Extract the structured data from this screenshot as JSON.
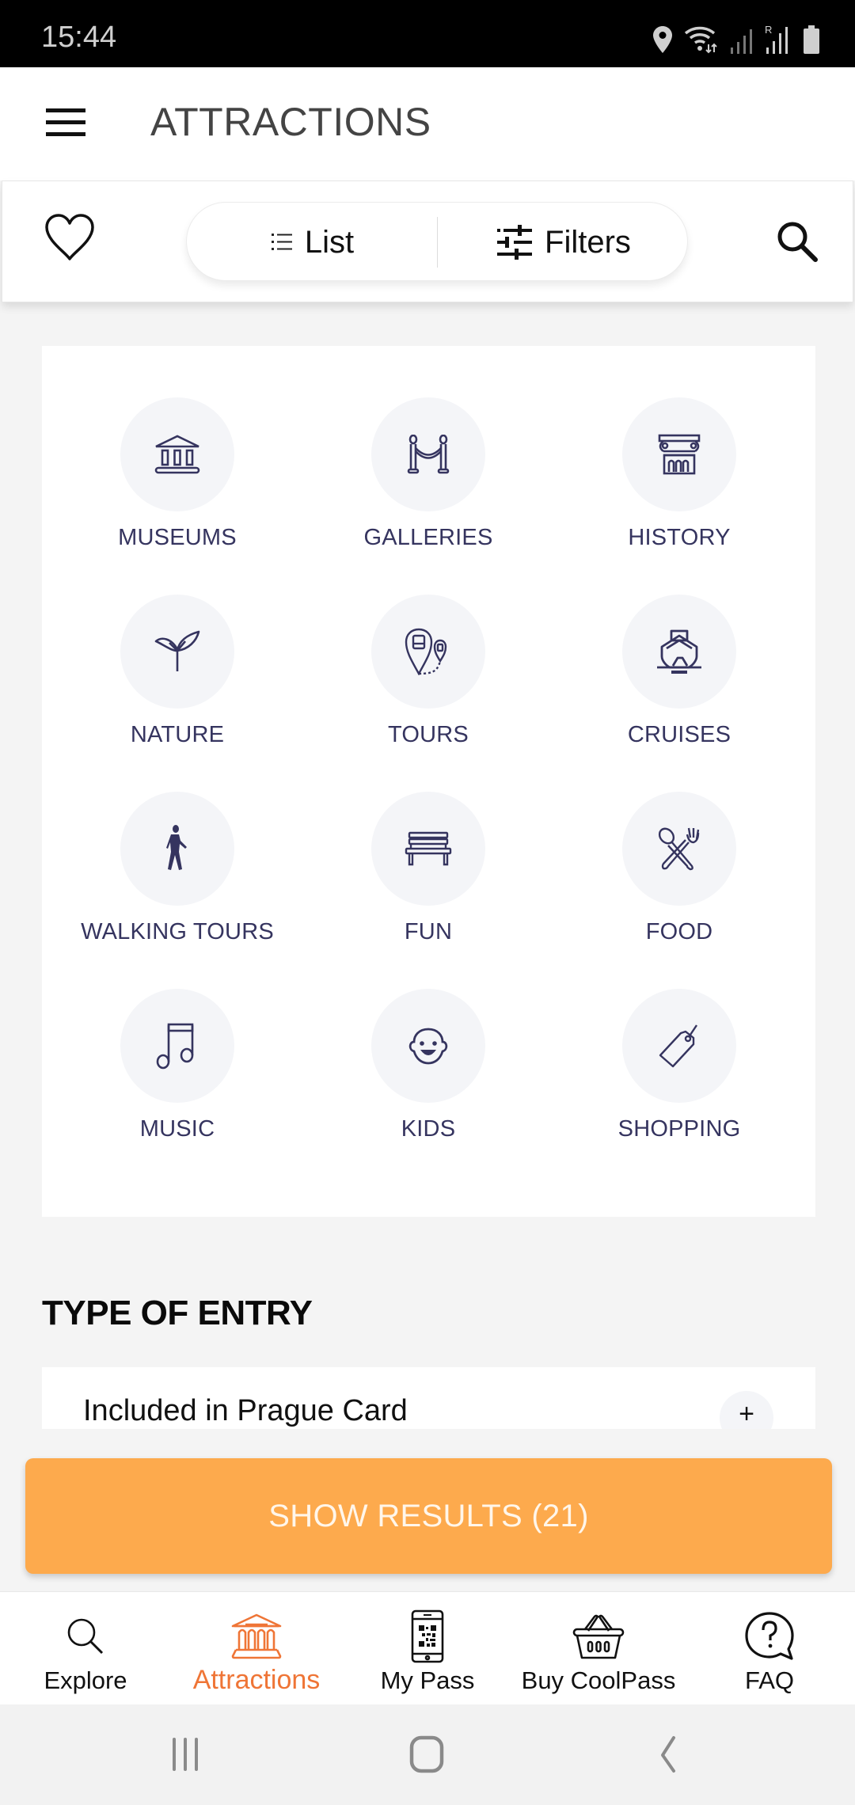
{
  "status_bar": {
    "time": "15:44",
    "icons": [
      "location-icon",
      "wifi-icon",
      "signal-icon",
      "roaming-signal-icon",
      "battery-icon"
    ],
    "roaming_label": "R"
  },
  "header": {
    "title": "ATTRACTIONS",
    "menu_icon": "hamburger-menu-icon"
  },
  "toolbar": {
    "favorites_icon": "heart-icon",
    "list_label": "List",
    "filters_label": "Filters",
    "search_icon": "search-icon"
  },
  "categories": [
    {
      "label": "MUSEUMS",
      "icon": "museum-icon"
    },
    {
      "label": "GALLERIES",
      "icon": "gallery-rope-icon"
    },
    {
      "label": "HISTORY",
      "icon": "column-icon"
    },
    {
      "label": "NATURE",
      "icon": "sprout-icon"
    },
    {
      "label": "TOURS",
      "icon": "tour-pins-icon"
    },
    {
      "label": "CRUISES",
      "icon": "ship-icon"
    },
    {
      "label": "WALKING TOURS",
      "icon": "walking-person-icon"
    },
    {
      "label": "FUN",
      "icon": "bench-icon"
    },
    {
      "label": "FOOD",
      "icon": "spoon-fork-icon"
    },
    {
      "label": "MUSIC",
      "icon": "music-note-icon"
    },
    {
      "label": "KIDS",
      "icon": "baby-face-icon"
    },
    {
      "label": "SHOPPING",
      "icon": "price-tag-icon"
    }
  ],
  "type_of_entry": {
    "heading": "TYPE OF ENTRY",
    "options": [
      {
        "label": "Included in Prague Card",
        "action": "+"
      }
    ]
  },
  "show_results": {
    "label": "SHOW RESULTS (21)",
    "count": 21
  },
  "bottom_nav": {
    "active_index": 1,
    "items": [
      {
        "label": "Explore",
        "icon": "search-icon"
      },
      {
        "label": "Attractions",
        "icon": "museum-icon"
      },
      {
        "label": "My Pass",
        "icon": "phone-qr-icon"
      },
      {
        "label": "Buy CoolPass",
        "icon": "basket-icon"
      },
      {
        "label": "FAQ",
        "icon": "question-bubble-icon"
      }
    ]
  },
  "colors": {
    "accent_orange": "#fdaa4d",
    "active_nav": "#ef7536",
    "category_text": "#35345f",
    "background": "#f4f4f4"
  }
}
